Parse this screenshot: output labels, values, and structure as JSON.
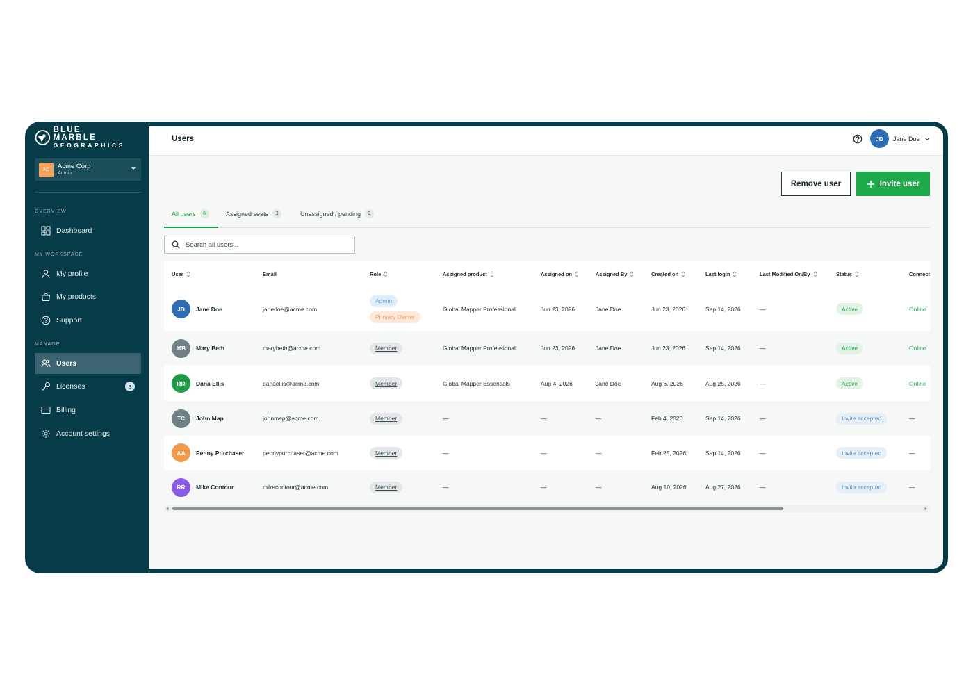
{
  "brand": {
    "line1": "BLUE MARBLE",
    "line2": "GEOGRAPHICS"
  },
  "org": {
    "avatar": "AC",
    "name": "Acme Corp",
    "role": "Admin"
  },
  "sidebar": {
    "overview_label": "OVERVIEW",
    "workspace_label": "MY WORKSPACE",
    "manage_label": "MANAGE",
    "items": [
      {
        "label": "Dashboard",
        "icon": "dashboard-icon"
      },
      {
        "label": "My profile",
        "icon": "user-icon"
      },
      {
        "label": "My products",
        "icon": "bag-icon"
      },
      {
        "label": "Support",
        "icon": "help-icon"
      },
      {
        "label": "Users",
        "icon": "users-icon",
        "active": true
      },
      {
        "label": "Licenses",
        "icon": "key-icon",
        "badge": "3"
      },
      {
        "label": "Billing",
        "icon": "card-icon"
      },
      {
        "label": "Account settings",
        "icon": "gear-icon"
      }
    ]
  },
  "header": {
    "title": "Users",
    "user_initials": "JD",
    "user_name": "Jane Doe"
  },
  "actions": {
    "remove": "Remove user",
    "invite": "Invite user"
  },
  "tabs": [
    {
      "label": "All users",
      "count": "6",
      "active": true
    },
    {
      "label": "Assigned seats",
      "count": "3"
    },
    {
      "label": "Unassigned / pending",
      "count": "3"
    }
  ],
  "search": {
    "placeholder": "Search all users..."
  },
  "table": {
    "columns": [
      "User",
      "Email",
      "Role",
      "Assigned product",
      "Assigned on",
      "Assigned By",
      "Created on",
      "Last login",
      "Last Modified On/By",
      "Status",
      "Connect"
    ],
    "rows": [
      {
        "initials": "JD",
        "avatar_color": "#2d6db5",
        "name": "Jane Doe",
        "email": "janedoe@acme.com",
        "roles": [
          "Admin",
          "Primary Owner"
        ],
        "product": "Global Mapper Professional",
        "assigned_on": "Jun 23, 2026",
        "assigned_by": "Jane Doe",
        "created_on": "Jun 23, 2026",
        "last_login": "Sep 14, 2026",
        "last_modified": "—",
        "status": "Active",
        "connection": "Online"
      },
      {
        "initials": "MB",
        "avatar_color": "#6f8086",
        "name": "Mary Beth",
        "email": "marybeth@acme.com",
        "roles": [
          "Member"
        ],
        "product": "Global Mapper Professional",
        "assigned_on": "Jun 23, 2026",
        "assigned_by": "Jane Doe",
        "created_on": "Jun 23, 2026",
        "last_login": "Sep 14, 2026",
        "last_modified": "—",
        "status": "Active",
        "connection": "Online"
      },
      {
        "initials": "RR",
        "avatar_color": "#1f9b47",
        "name": "Dana Ellis",
        "email": "danaellis@acme.com",
        "roles": [
          "Member"
        ],
        "product": "Global Mapper Essentials",
        "assigned_on": "Aug 4, 2026",
        "assigned_by": "Jane Doe",
        "created_on": "Aug 6, 2026",
        "last_login": "Aug 25, 2026",
        "last_modified": "—",
        "status": "Active",
        "connection": "Online"
      },
      {
        "initials": "TC",
        "avatar_color": "#6f8086",
        "name": "John Map",
        "email": "johnmap@acme.com",
        "roles": [
          "Member"
        ],
        "product": "—",
        "assigned_on": "—",
        "assigned_by": "—",
        "created_on": "Feb 4, 2026",
        "last_login": "Sep 14, 2026",
        "last_modified": "—",
        "status": "Invite accepted",
        "connection": "—"
      },
      {
        "initials": "AA",
        "avatar_color": "#f39a4a",
        "name": "Penny Purchaser",
        "email": "pennypurchaser@acme.com",
        "roles": [
          "Member"
        ],
        "product": "—",
        "assigned_on": "—",
        "assigned_by": "—",
        "created_on": "Feb 25, 2026",
        "last_login": "Sep 14, 2026",
        "last_modified": "—",
        "status": "Invite accepted",
        "connection": "—"
      },
      {
        "initials": "RR",
        "avatar_color": "#8a5be6",
        "name": "Mike Contour",
        "email": "mikecontour@acme.com",
        "roles": [
          "Member"
        ],
        "product": "—",
        "assigned_on": "—",
        "assigned_by": "—",
        "created_on": "Aug 10, 2026",
        "last_login": "Aug 27, 2026",
        "last_modified": "—",
        "status": "Invite accepted",
        "connection": "—"
      }
    ]
  },
  "colors": {
    "sidebar": "#063b48",
    "accent": "#1eaa4a",
    "active_nav": "#3b6470"
  }
}
